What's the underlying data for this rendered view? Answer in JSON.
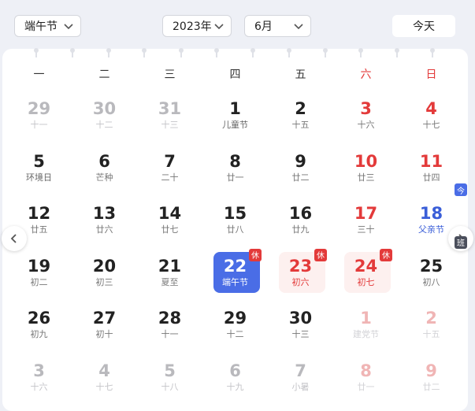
{
  "toolbar": {
    "holiday_select": "端午节",
    "year_select": "2023年",
    "month_select": "6月",
    "today_label": "今天"
  },
  "weekdays": [
    {
      "label": "一",
      "weekend": false
    },
    {
      "label": "二",
      "weekend": false
    },
    {
      "label": "三",
      "weekend": false
    },
    {
      "label": "四",
      "weekend": false
    },
    {
      "label": "五",
      "weekend": false
    },
    {
      "label": "六",
      "weekend": true
    },
    {
      "label": "日",
      "weekend": true
    }
  ],
  "days": [
    {
      "num": "29",
      "lunar": "十一",
      "state": "outside"
    },
    {
      "num": "30",
      "lunar": "十二",
      "state": "outside"
    },
    {
      "num": "31",
      "lunar": "十三",
      "state": "outside"
    },
    {
      "num": "1",
      "lunar": "儿童节",
      "state": "current",
      "festival": true
    },
    {
      "num": "2",
      "lunar": "十五",
      "state": "current"
    },
    {
      "num": "3",
      "lunar": "十六",
      "state": "current",
      "weekend": true
    },
    {
      "num": "4",
      "lunar": "十七",
      "state": "current",
      "weekend": true
    },
    {
      "num": "5",
      "lunar": "环境日",
      "state": "current",
      "festival": true
    },
    {
      "num": "6",
      "lunar": "芒种",
      "state": "current"
    },
    {
      "num": "7",
      "lunar": "二十",
      "state": "current"
    },
    {
      "num": "8",
      "lunar": "廿一",
      "state": "current"
    },
    {
      "num": "9",
      "lunar": "廿二",
      "state": "current"
    },
    {
      "num": "10",
      "lunar": "廿三",
      "state": "current",
      "weekend": true
    },
    {
      "num": "11",
      "lunar": "廿四",
      "state": "current",
      "weekend": true
    },
    {
      "num": "12",
      "lunar": "廿五",
      "state": "current"
    },
    {
      "num": "13",
      "lunar": "廿六",
      "state": "current"
    },
    {
      "num": "14",
      "lunar": "廿七",
      "state": "current"
    },
    {
      "num": "15",
      "lunar": "廿八",
      "state": "current"
    },
    {
      "num": "16",
      "lunar": "廿九",
      "state": "current"
    },
    {
      "num": "17",
      "lunar": "三十",
      "state": "current",
      "weekend": true
    },
    {
      "num": "18",
      "lunar": "父亲节",
      "state": "current",
      "special": "blue",
      "badge": {
        "text": "今",
        "color": "blue"
      }
    },
    {
      "num": "19",
      "lunar": "初二",
      "state": "current"
    },
    {
      "num": "20",
      "lunar": "初三",
      "state": "current"
    },
    {
      "num": "21",
      "lunar": "夏至",
      "state": "current"
    },
    {
      "num": "22",
      "lunar": "端午节",
      "state": "selected",
      "badge": {
        "text": "休",
        "color": "red"
      }
    },
    {
      "num": "23",
      "lunar": "初六",
      "state": "holiday",
      "badge": {
        "text": "休",
        "color": "red"
      }
    },
    {
      "num": "24",
      "lunar": "初七",
      "state": "holiday",
      "badge": {
        "text": "休",
        "color": "red"
      }
    },
    {
      "num": "25",
      "lunar": "初八",
      "state": "current",
      "badge": {
        "text": "班",
        "color": "gray"
      }
    },
    {
      "num": "26",
      "lunar": "初九",
      "state": "current"
    },
    {
      "num": "27",
      "lunar": "初十",
      "state": "current"
    },
    {
      "num": "28",
      "lunar": "十一",
      "state": "current"
    },
    {
      "num": "29",
      "lunar": "十二",
      "state": "current"
    },
    {
      "num": "30",
      "lunar": "十三",
      "state": "current"
    },
    {
      "num": "1",
      "lunar": "建党节",
      "state": "outside",
      "weekend": true
    },
    {
      "num": "2",
      "lunar": "十五",
      "state": "outside",
      "weekend": true
    },
    {
      "num": "3",
      "lunar": "十六",
      "state": "outside"
    },
    {
      "num": "4",
      "lunar": "十七",
      "state": "outside"
    },
    {
      "num": "5",
      "lunar": "十八",
      "state": "outside"
    },
    {
      "num": "6",
      "lunar": "十九",
      "state": "outside"
    },
    {
      "num": "7",
      "lunar": "小暑",
      "state": "outside"
    },
    {
      "num": "8",
      "lunar": "廿一",
      "state": "outside",
      "weekend": true
    },
    {
      "num": "9",
      "lunar": "廿二",
      "state": "outside",
      "weekend": true
    }
  ],
  "icons": {
    "prev": "chevron-left-icon",
    "next": "chevron-right-icon",
    "dropdown": "chevron-down-icon"
  },
  "colors": {
    "accent": "#4a6de6",
    "weekend": "#e33a3a",
    "holiday_bg": "#fdf0ef",
    "work_badge": "#4b4f5c"
  }
}
